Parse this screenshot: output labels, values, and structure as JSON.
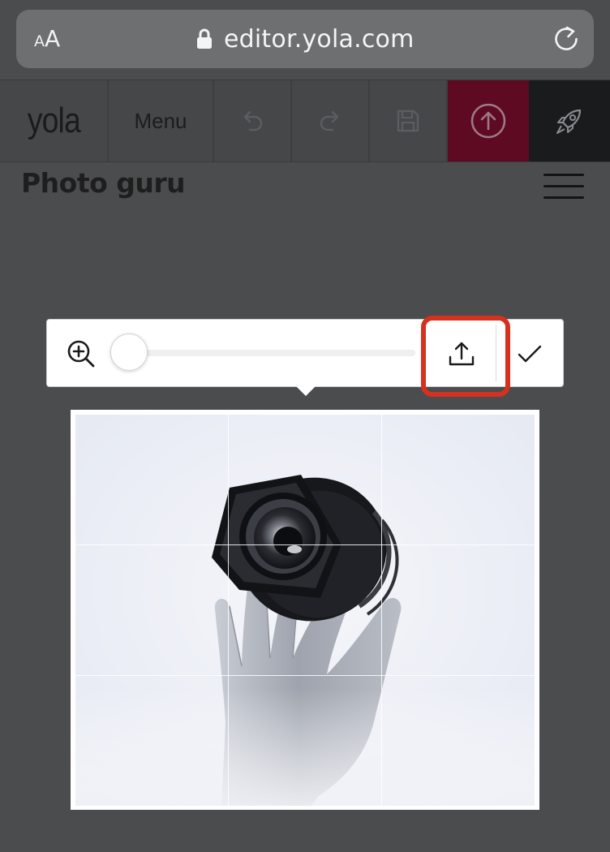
{
  "browser": {
    "text_size_label_small": "A",
    "text_size_label_big": "A",
    "url": "editor.yola.com"
  },
  "editor_toolbar": {
    "logo": "yola",
    "menu_label": "Menu",
    "publish_color": "#5d0a22",
    "launch_color": "#1a1b1d"
  },
  "site": {
    "title": "Photo guru"
  },
  "image_editor": {
    "zoom_level": 0,
    "highlight_color": "#d6301f"
  },
  "icons": {
    "text_size": "text-size-icon",
    "lock": "lock-icon",
    "reload": "reload-icon",
    "undo": "undo-icon",
    "redo": "redo-icon",
    "save": "save-icon",
    "publish": "upload-circle-icon",
    "launch": "rocket-icon",
    "hamburger": "hamburger-icon",
    "zoom_in": "zoom-in-icon",
    "upload": "upload-icon",
    "confirm": "checkmark-icon"
  }
}
